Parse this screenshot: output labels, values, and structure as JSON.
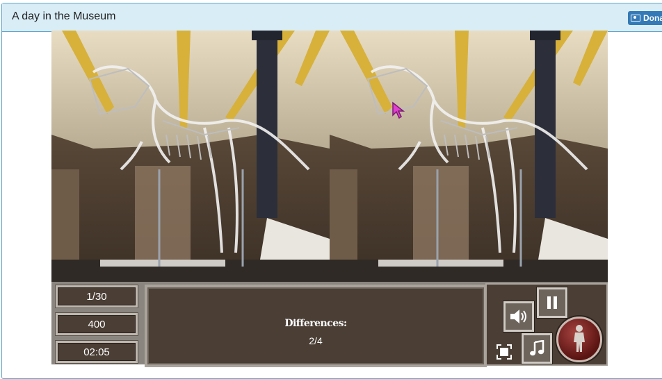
{
  "header": {
    "title": "A day in the Museum",
    "donate_label": "Dona"
  },
  "hud": {
    "level": "1/30",
    "score": "400",
    "timer": "02:05",
    "differences_label": "Differences:",
    "differences_count": "2/4"
  },
  "icons": [
    "money-icon",
    "pause-icon",
    "volume-icon",
    "music-icon",
    "fullscreen-icon",
    "statue-medal-icon"
  ],
  "colors": {
    "header_bg": "#d9edf7",
    "donate_bg": "#337ab7",
    "hud_panel": "#4a3e35",
    "hud_border": "#a9a39c"
  }
}
